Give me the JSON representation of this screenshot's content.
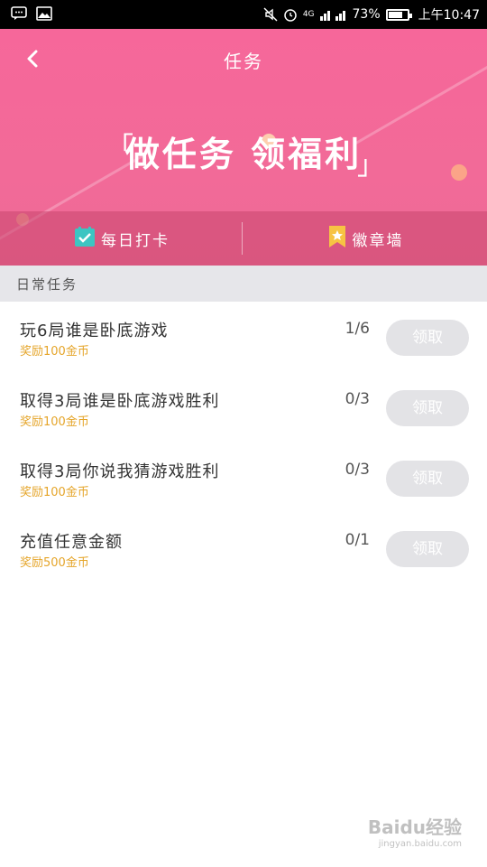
{
  "status_bar": {
    "time": "上午10:47",
    "battery_text": "73%",
    "battery_level": 0.73,
    "network": "4G",
    "icons": [
      "message-icon",
      "image-icon",
      "mute-icon",
      "alarm-icon",
      "signal-icon",
      "battery-icon"
    ]
  },
  "header": {
    "title": "任务",
    "banner_text": "做任务 领福利",
    "bracket_left": "「",
    "bracket_right": "」",
    "accent_color": "#f26a98"
  },
  "tabs": [
    {
      "label": "每日打卡",
      "icon": "checkin-icon"
    },
    {
      "label": "徽章墙",
      "icon": "badge-icon"
    }
  ],
  "section": {
    "title": "日常任务"
  },
  "tasks": [
    {
      "name": "玩6局谁是卧底游戏",
      "reward": "奖励100金币",
      "progress": "1/6",
      "button": "领取"
    },
    {
      "name": "取得3局谁是卧底游戏胜利",
      "reward": "奖励100金币",
      "progress": "0/3",
      "button": "领取"
    },
    {
      "name": "取得3局你说我猜游戏胜利",
      "reward": "奖励100金币",
      "progress": "0/3",
      "button": "领取"
    },
    {
      "name": "充值任意金额",
      "reward": "奖励500金币",
      "progress": "0/1",
      "button": "领取"
    }
  ],
  "watermark": {
    "brand": "Baidu经验",
    "url": "jingyan.baidu.com"
  }
}
